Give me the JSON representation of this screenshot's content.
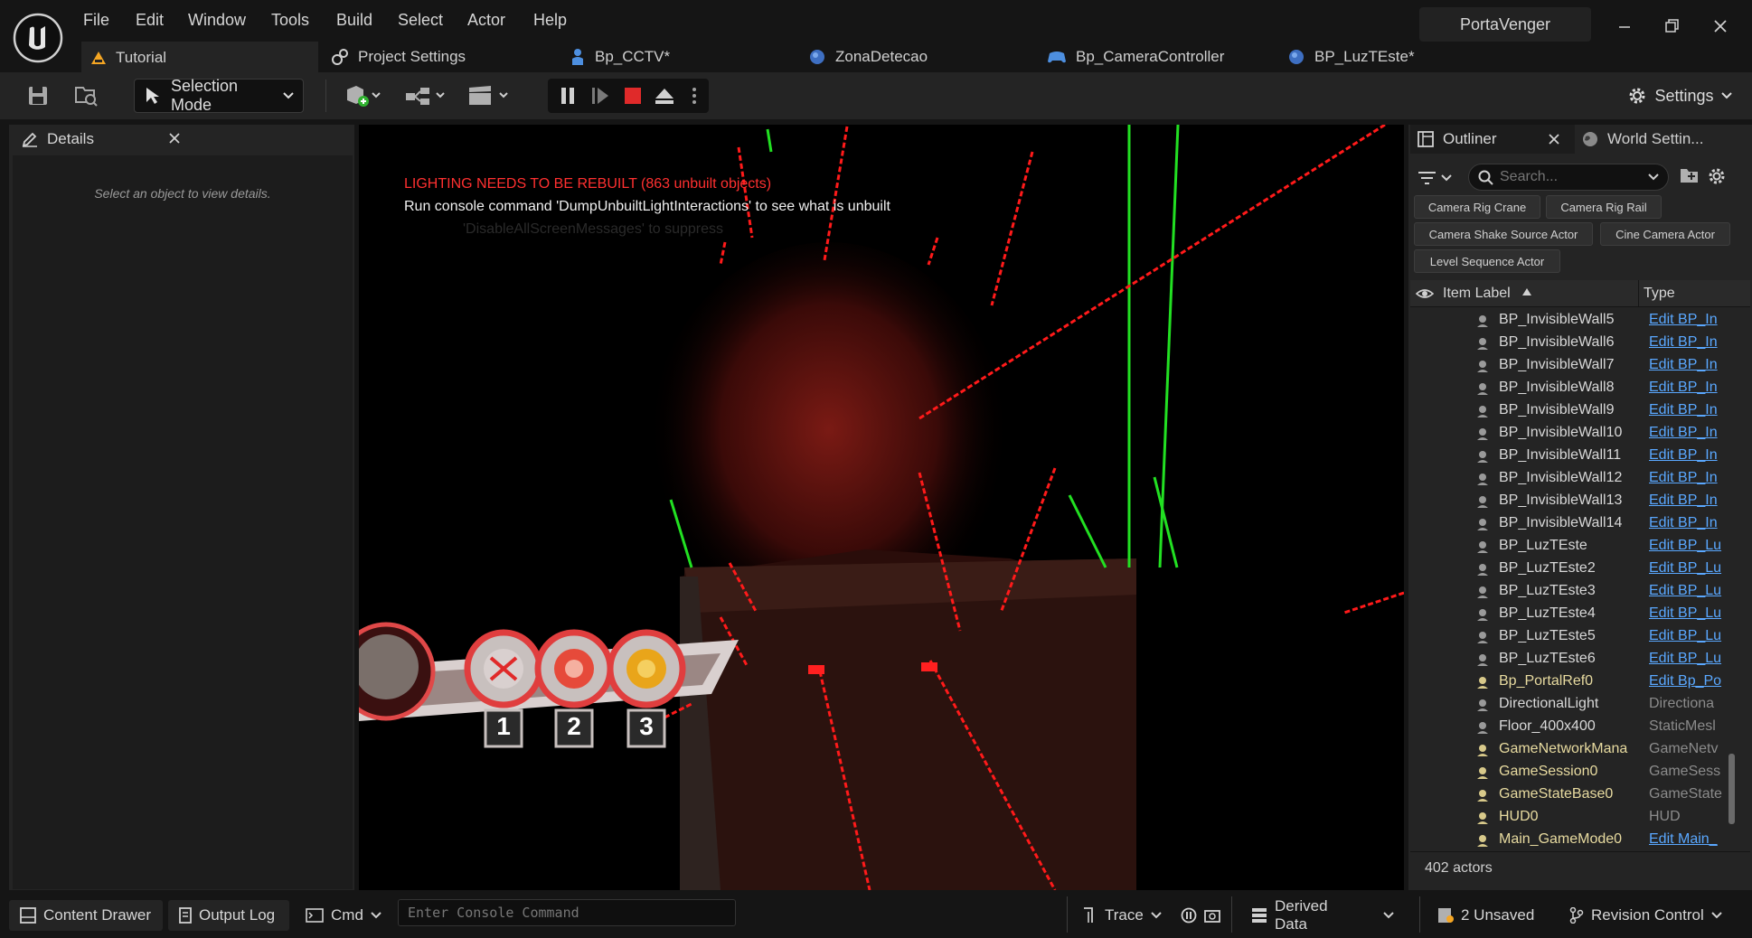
{
  "menu": [
    "File",
    "Edit",
    "Window",
    "Tools",
    "Build",
    "Select",
    "Actor",
    "Help"
  ],
  "project_name": "PortaVenger",
  "tabs": [
    {
      "label": "Tutorial",
      "icon": "level-icon",
      "active": true
    },
    {
      "label": "Project Settings",
      "icon": "settings-icon"
    },
    {
      "label": "Bp_CCTV*",
      "icon": "blueprint-icon"
    },
    {
      "label": "ZonaDetecao",
      "icon": "blueprint-icon"
    },
    {
      "label": "Bp_CameraController",
      "icon": "gamepad-icon"
    },
    {
      "label": "BP_LuzTEste*",
      "icon": "blueprint-icon"
    }
  ],
  "toolbar": {
    "selection_mode": "Selection Mode",
    "settings": "Settings"
  },
  "details": {
    "title": "Details",
    "empty": "Select an object to view details."
  },
  "viewport": {
    "msg_lighting": "LIGHTING NEEDS TO BE REBUILT (863 unbuilt objects)",
    "msg_console": "Run console command 'DumpUnbuiltLightInteractions' to see what is unbuilt",
    "msg_suppress": "'DisableAllScreenMessages' to suppress",
    "hud_slots": [
      "1",
      "2",
      "3"
    ]
  },
  "outliner": {
    "title": "Outliner",
    "world_tab": "World Settin...",
    "search_placeholder": "Search...",
    "chips": [
      "Camera Rig Crane",
      "Camera Rig Rail",
      "Camera Shake Source Actor",
      "Cine Camera Actor",
      "Level Sequence Actor"
    ],
    "col_label": "Item Label",
    "col_type": "Type",
    "rows": [
      {
        "label": "BP_InvisibleWall5",
        "type": "Edit BP_In",
        "link": true
      },
      {
        "label": "BP_InvisibleWall6",
        "type": "Edit BP_In",
        "link": true
      },
      {
        "label": "BP_InvisibleWall7",
        "type": "Edit BP_In",
        "link": true
      },
      {
        "label": "BP_InvisibleWall8",
        "type": "Edit BP_In",
        "link": true
      },
      {
        "label": "BP_InvisibleWall9",
        "type": "Edit BP_In",
        "link": true
      },
      {
        "label": "BP_InvisibleWall10",
        "type": "Edit BP_In",
        "link": true
      },
      {
        "label": "BP_InvisibleWall11",
        "type": "Edit BP_In",
        "link": true
      },
      {
        "label": "BP_InvisibleWall12",
        "type": "Edit BP_In",
        "link": true
      },
      {
        "label": "BP_InvisibleWall13",
        "type": "Edit BP_In",
        "link": true
      },
      {
        "label": "BP_InvisibleWall14",
        "type": "Edit BP_In",
        "link": true
      },
      {
        "label": "BP_LuzTEste",
        "type": "Edit BP_Lu",
        "link": true
      },
      {
        "label": "BP_LuzTEste2",
        "type": "Edit BP_Lu",
        "link": true
      },
      {
        "label": "BP_LuzTEste3",
        "type": "Edit BP_Lu",
        "link": true
      },
      {
        "label": "BP_LuzTEste4",
        "type": "Edit BP_Lu",
        "link": true
      },
      {
        "label": "BP_LuzTEste5",
        "type": "Edit BP_Lu",
        "link": true
      },
      {
        "label": "BP_LuzTEste6",
        "type": "Edit BP_Lu",
        "link": true
      },
      {
        "label": "Bp_PortalRef0",
        "type": "Edit Bp_Po",
        "link": true,
        "highlight": true
      },
      {
        "label": "DirectionalLight",
        "type": "Directiona",
        "link": false
      },
      {
        "label": "Floor_400x400",
        "type": "StaticMesl",
        "link": false
      },
      {
        "label": "GameNetworkMana",
        "type": "GameNetv",
        "link": false,
        "highlight": true
      },
      {
        "label": "GameSession0",
        "type": "GameSess",
        "link": false,
        "highlight": true
      },
      {
        "label": "GameStateBase0",
        "type": "GameState",
        "link": false,
        "highlight": true
      },
      {
        "label": "HUD0",
        "type": "HUD",
        "link": false,
        "highlight": true
      },
      {
        "label": "Main_GameMode0",
        "type": "Edit Main_",
        "link": true,
        "highlight": true
      }
    ],
    "actor_count": "402 actors"
  },
  "statusbar": {
    "content_drawer": "Content Drawer",
    "output_log": "Output Log",
    "cmd": "Cmd",
    "console_placeholder": "Enter Console Command",
    "trace": "Trace",
    "derived_data": "Derived Data",
    "unsaved": "2 Unsaved",
    "revision_control": "Revision Control"
  },
  "colors": {
    "accent_orange": "#f5a623",
    "link_blue": "#5aa8ff",
    "error_red": "#ff3030",
    "laser_red": "#ff1a1a",
    "laser_green": "#22e022"
  }
}
